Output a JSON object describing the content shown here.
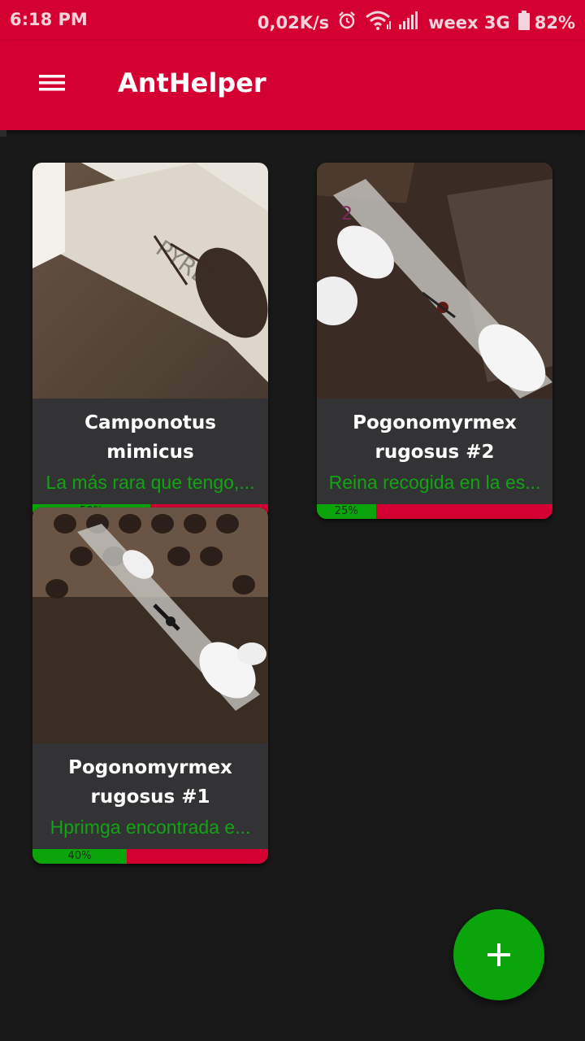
{
  "status_bar": {
    "time": "6:18 PM",
    "net_speed": "0,02K/s",
    "carrier": "weex 3G",
    "battery": "82%",
    "icons": [
      "alarm-icon",
      "wifi-icon",
      "signal-icon",
      "battery-icon"
    ]
  },
  "app_bar": {
    "title": "AntHelper",
    "menu_icon": "hamburger-menu-icon",
    "color": "#d50032"
  },
  "cards": [
    {
      "name": "Camponotus mimicus",
      "description": "La más rara que tengo,...",
      "progress": 0.5,
      "progress_label": "50%"
    },
    {
      "name": "Pogonomyrmex rugosus #2",
      "description": "Reina recogida en la es...",
      "progress": 0.25,
      "progress_label": "25%"
    },
    {
      "name": "Pogonomyrmex rugosus #1",
      "description": "Hprimga encontrada e...",
      "progress": 0.4,
      "progress_label": "40%"
    }
  ],
  "fab": {
    "icon": "plus-icon",
    "color": "#0aa50a"
  },
  "colors": {
    "accent_red": "#d50032",
    "accent_green": "#0aa50a",
    "background": "#191919",
    "card": "#333335"
  }
}
